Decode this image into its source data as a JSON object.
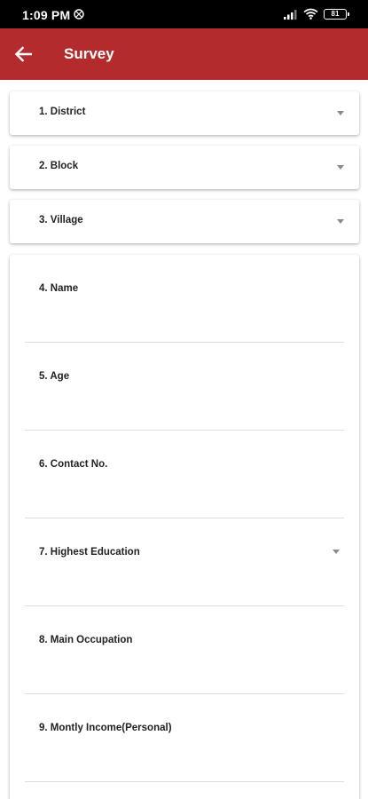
{
  "status_bar": {
    "time": "1:09 PM",
    "battery": "81",
    "icons": [
      "notification-icon",
      "signal-icon",
      "wifi-icon",
      "battery-icon"
    ]
  },
  "app_bar": {
    "title": "Survey",
    "back_icon": "arrow-left-icon",
    "background_color": "#b32b2c"
  },
  "dropdowns": [
    {
      "label": "1. District"
    },
    {
      "label": "2. Block"
    },
    {
      "label": "3. Village"
    }
  ],
  "form_fields": [
    {
      "label": "4. Name",
      "type": "text"
    },
    {
      "label": "5. Age",
      "type": "text"
    },
    {
      "label": "6. Contact No.",
      "type": "text"
    },
    {
      "label": "7. Highest Education",
      "type": "dropdown"
    },
    {
      "label": "8. Main Occupation",
      "type": "text"
    },
    {
      "label": "9. Montly Income(Personal)",
      "type": "text"
    }
  ]
}
